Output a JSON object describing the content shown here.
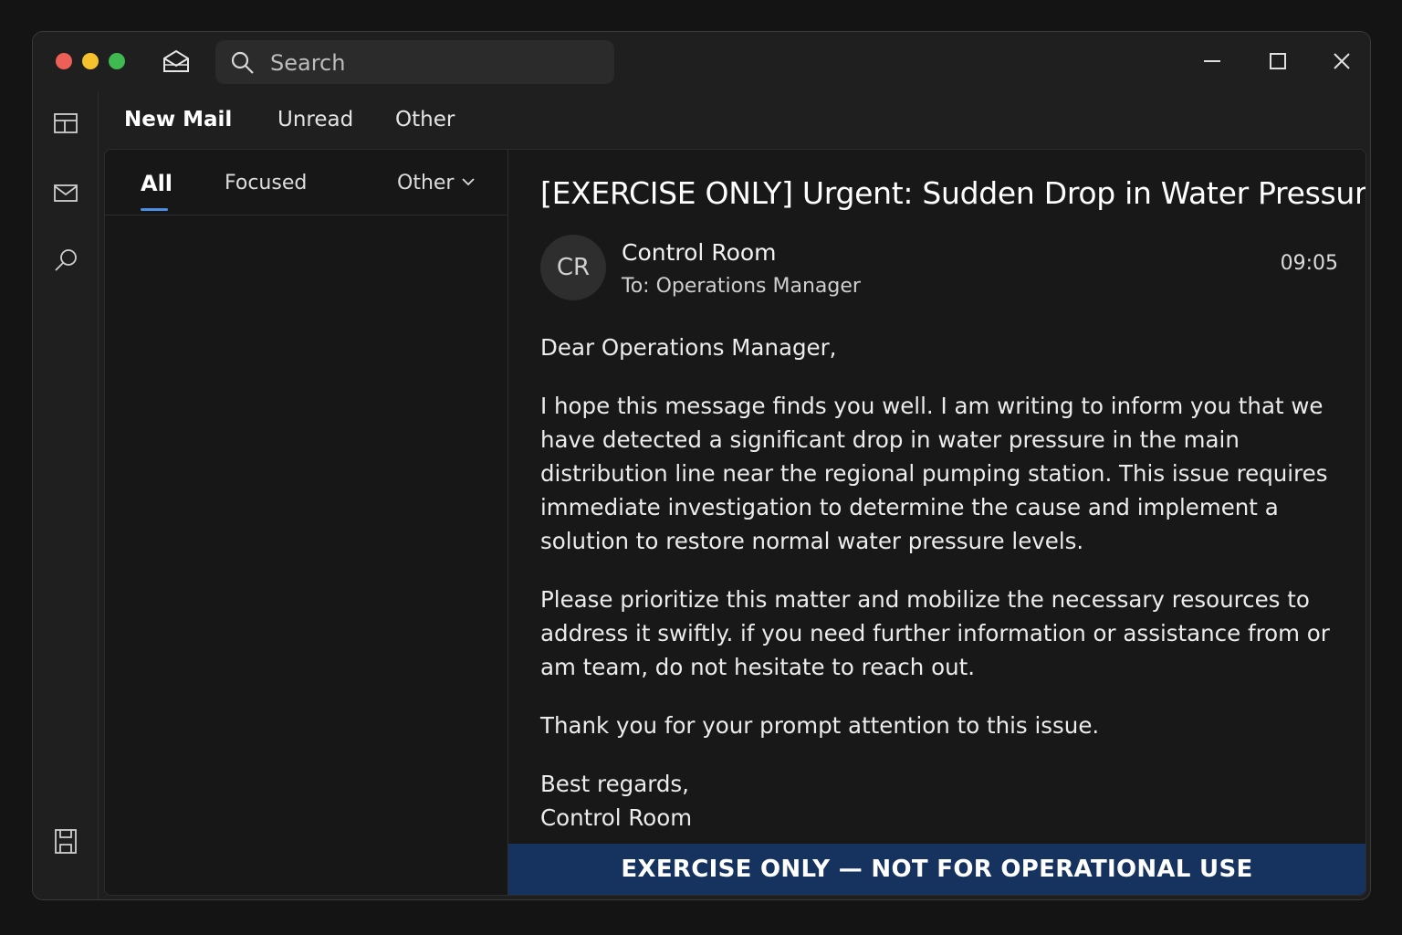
{
  "titlebar": {
    "search_placeholder": "Search"
  },
  "menubar": {
    "items": [
      "New Mail",
      "Unread",
      "Other"
    ]
  },
  "list": {
    "tabs": [
      "All",
      "Focused",
      "Other"
    ]
  },
  "message": {
    "subject": "[EXERCISE ONLY] Urgent: Sudden Drop in Water Pressure",
    "avatar_initials": "CR",
    "sender": "Control Room",
    "recipient": "To: Operations Manager",
    "time": "09:05",
    "greeting": "Dear Operations Manager,",
    "paragraph1": "I hope this message finds you well. I am writing to inform you that we have detected a significant drop in water pressure in the main distribution line near the regional pumping station. This issue requires immediate investigation to determine the cause and implement a solution to restore normal water pressure levels.",
    "paragraph2": "Please prioritize this matter and mobilize the necessary resources to address it swiftly. if you need further information or assistance from or am team, do not hesitate to reach out.",
    "paragraph3": "Thank you for your prompt attention to this issue.",
    "closing": "Best regards,",
    "signature": "Control Room"
  },
  "banner": {
    "text": "EXERCISE ONLY — NOT FOR OPERATIONAL USE",
    "color": "#16335f"
  },
  "icons": {
    "titlebar": [
      "mail-open-icon",
      "search-icon",
      "minimize-icon",
      "maximize-icon",
      "close-icon"
    ],
    "rail": [
      "layout-icon",
      "mail-icon",
      "search-icon",
      "save-icon"
    ]
  },
  "colors": {
    "accent": "#4c8ee6",
    "traffic_red": "#ee5f57",
    "traffic_yellow": "#f5c12e",
    "traffic_green": "#3fb950"
  }
}
